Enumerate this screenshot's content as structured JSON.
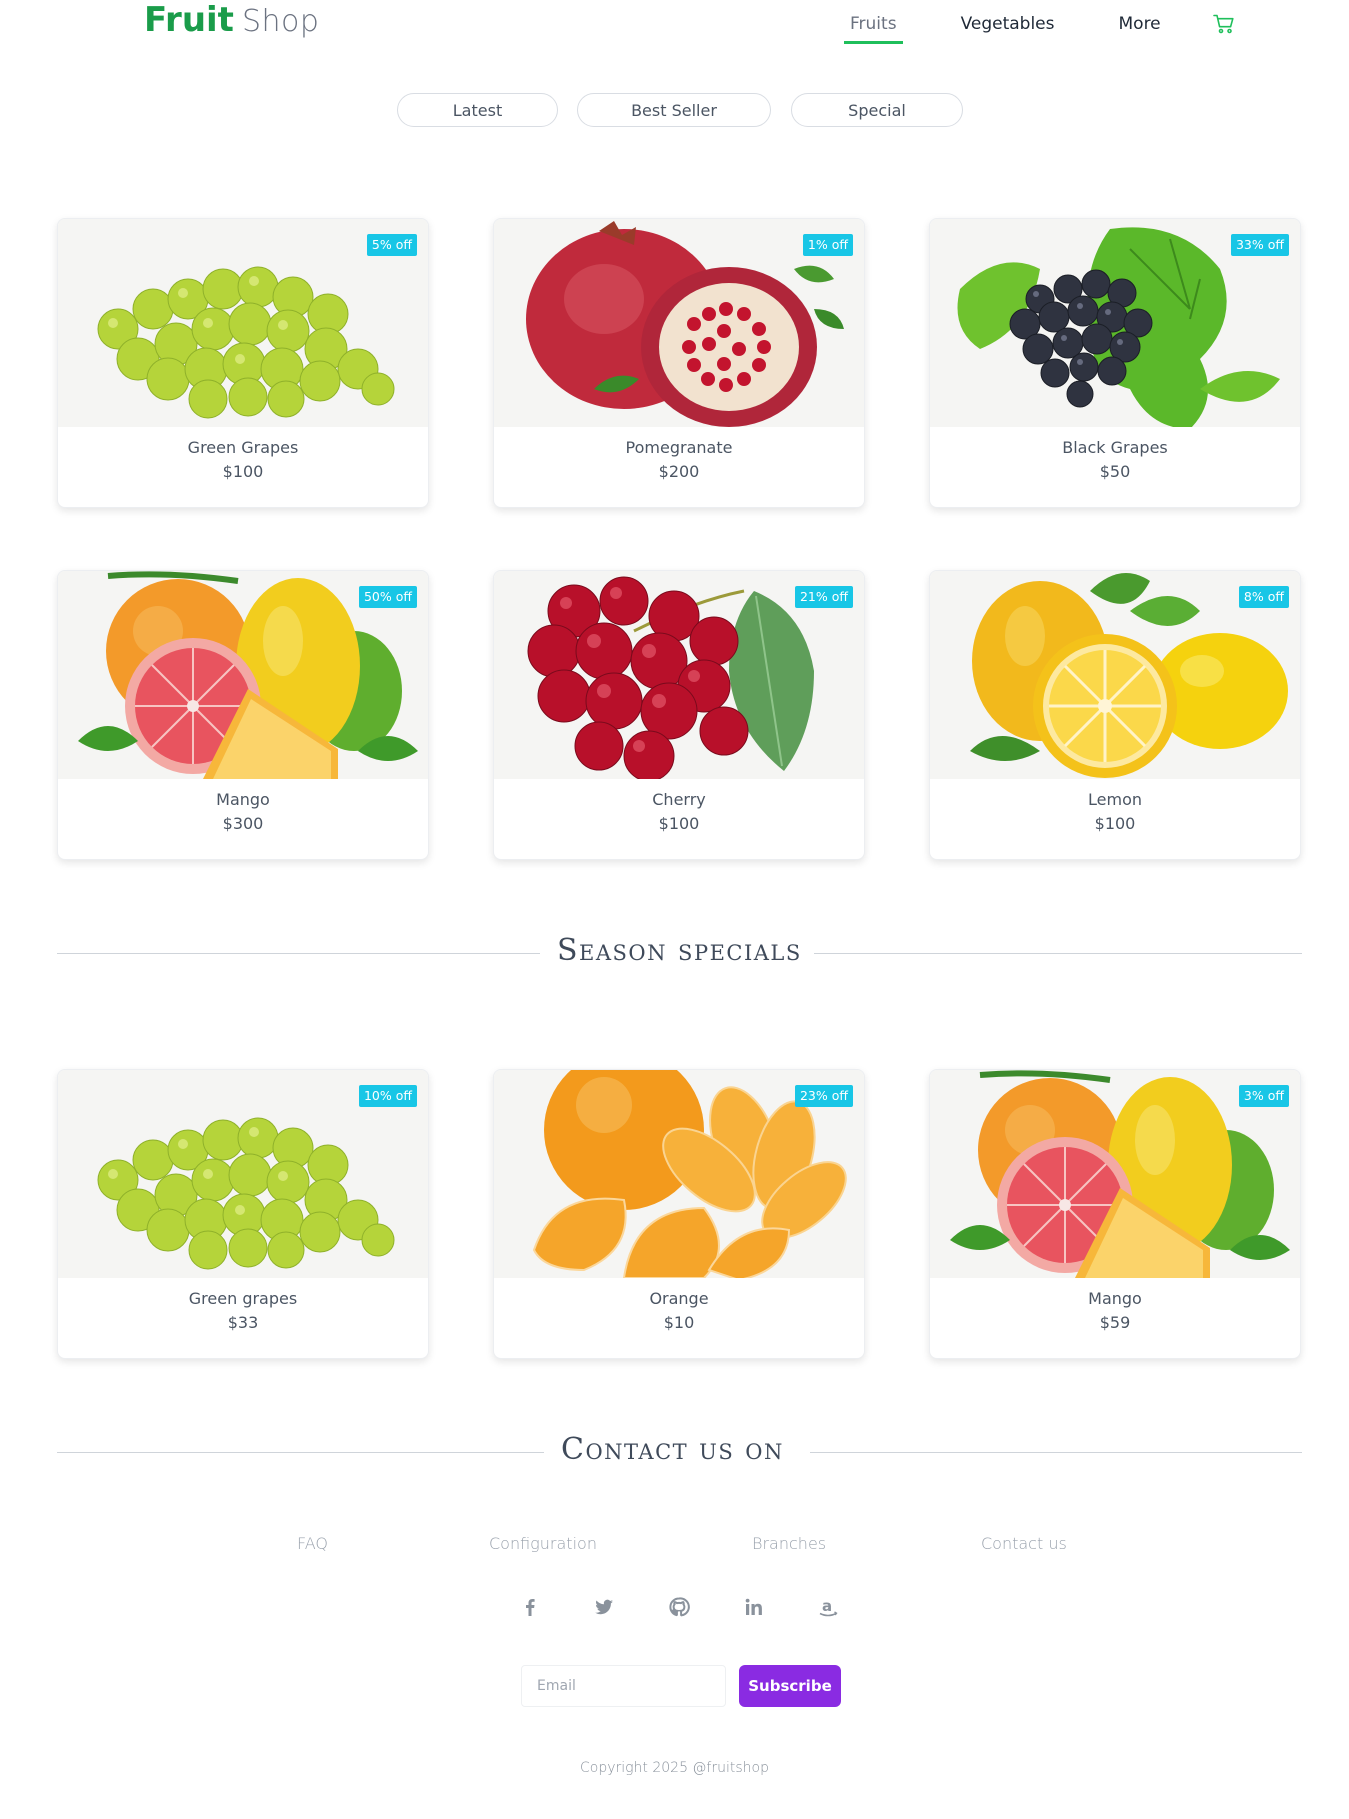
{
  "header": {
    "brand_primary": "Fruit",
    "brand_secondary": "Shop",
    "nav": [
      {
        "label": "Fruits",
        "active": true
      },
      {
        "label": "Vegetables",
        "active": false
      },
      {
        "label": "More",
        "active": false
      }
    ],
    "cart_icon": "cart-icon"
  },
  "filters": [
    "Latest",
    "Best Seller",
    "Special"
  ],
  "products": [
    {
      "name": "Green Grapes",
      "price": "$100",
      "badge": "5% off",
      "image": "green-grapes"
    },
    {
      "name": "Pomegranate",
      "price": "$200",
      "badge": "1% off",
      "image": "pomegranate"
    },
    {
      "name": "Black Grapes",
      "price": "$50",
      "badge": "33% off",
      "image": "black-grapes"
    },
    {
      "name": "Mango",
      "price": "$300",
      "badge": "50% off",
      "image": "citrus-mix"
    },
    {
      "name": "Cherry",
      "price": "$100",
      "badge": "21% off",
      "image": "cherry"
    },
    {
      "name": "Lemon",
      "price": "$100",
      "badge": "8% off",
      "image": "lemon"
    }
  ],
  "season": {
    "title": "Season specials",
    "products": [
      {
        "name": "Green grapes",
        "price": "$33",
        "badge": "10% off",
        "image": "green-grapes"
      },
      {
        "name": "Orange",
        "price": "$10",
        "badge": "23% off",
        "image": "orange"
      },
      {
        "name": "Mango",
        "price": "$59",
        "badge": "3% off",
        "image": "citrus-mix"
      }
    ]
  },
  "contact": {
    "title": "Contact us on",
    "links": [
      "FAQ",
      "Configuration",
      "Branches",
      "Contact us"
    ],
    "socials": [
      "facebook-icon",
      "twitter-icon",
      "github-icon",
      "linkedin-icon",
      "amazon-icon"
    ],
    "email_placeholder": "Email",
    "subscribe_label": "Subscribe",
    "copyright": "Copyright 2025 @fruitshop"
  },
  "colors": {
    "brand_green": "#1a9c4a",
    "nav_underline": "#1fbf5b",
    "badge": "#18c6e6",
    "subscribe": "#8a2be2"
  }
}
